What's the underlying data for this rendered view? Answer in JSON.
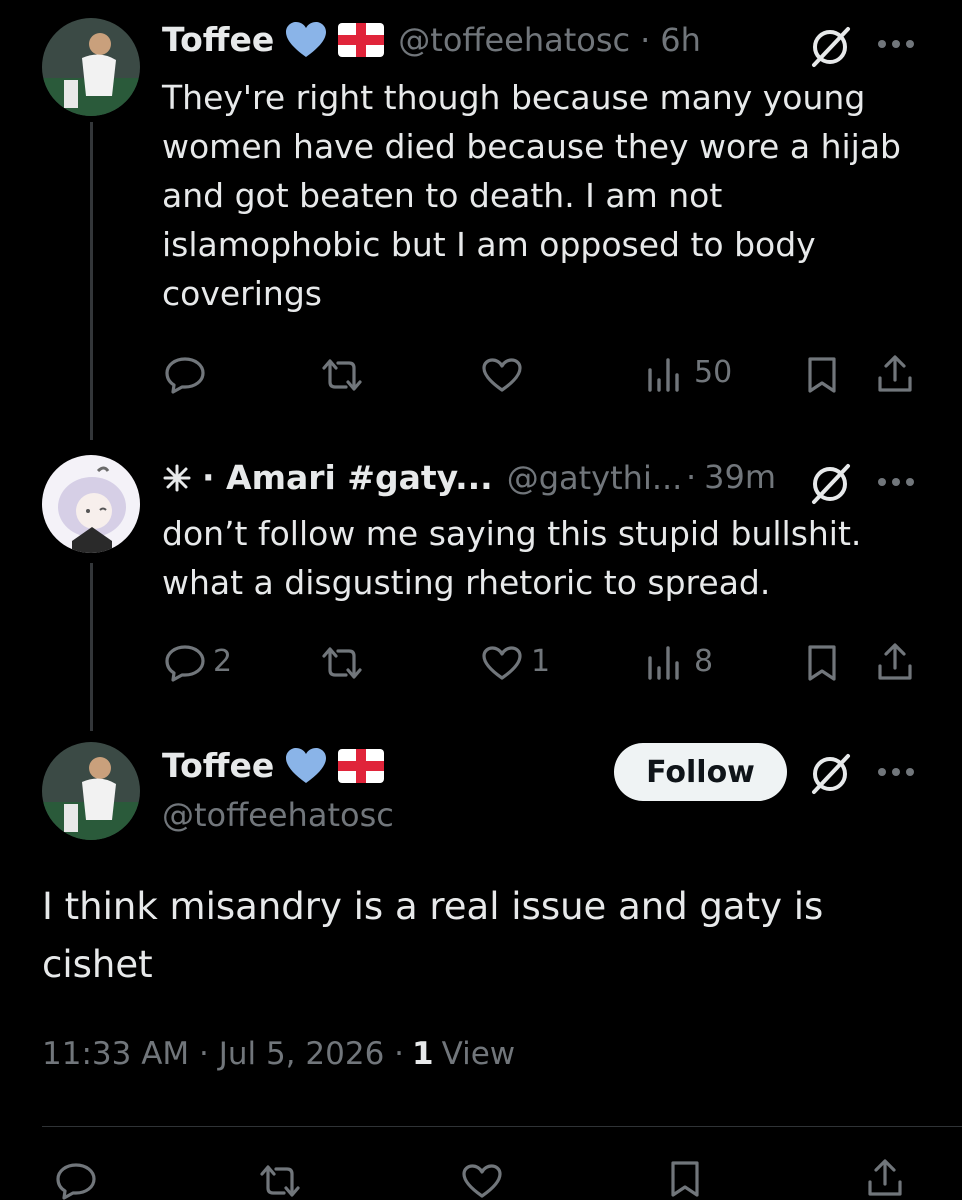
{
  "tweet1": {
    "name": "Toffee",
    "handle": "@toffeehatosc",
    "sep": "·",
    "time": "6h",
    "lines": [
      "They're right though because many young",
      "women have died because they wore a hijab",
      "and got beaten to death. I am not",
      "islamophobic but I am opposed to body",
      "coverings"
    ],
    "views": "50"
  },
  "tweet2": {
    "name": "· Amari #gaty...",
    "handle": "@gatythi...",
    "sep": "·",
    "time": "39m",
    "lines": [
      "don’t follow me saying this stupid bullshit.",
      "what a disgusting rhetoric to spread."
    ],
    "replies": "2",
    "likes": "1",
    "views": "8"
  },
  "main_tweet": {
    "name": "Toffee",
    "handle": "@toffeehatosc",
    "follow_label": "Follow",
    "lines": [
      "I think misandry is a real issue and gaty is",
      "cishet"
    ],
    "timestamp": "11:33 AM · Jul 5, 2026 ·",
    "view_count": "1",
    "view_label": "View"
  },
  "colors": {
    "background": "#000000",
    "text": "#e7e9ea",
    "muted": "#71767b",
    "heart_badge": "#8ab4e8",
    "flag_red": "#e0243a"
  }
}
